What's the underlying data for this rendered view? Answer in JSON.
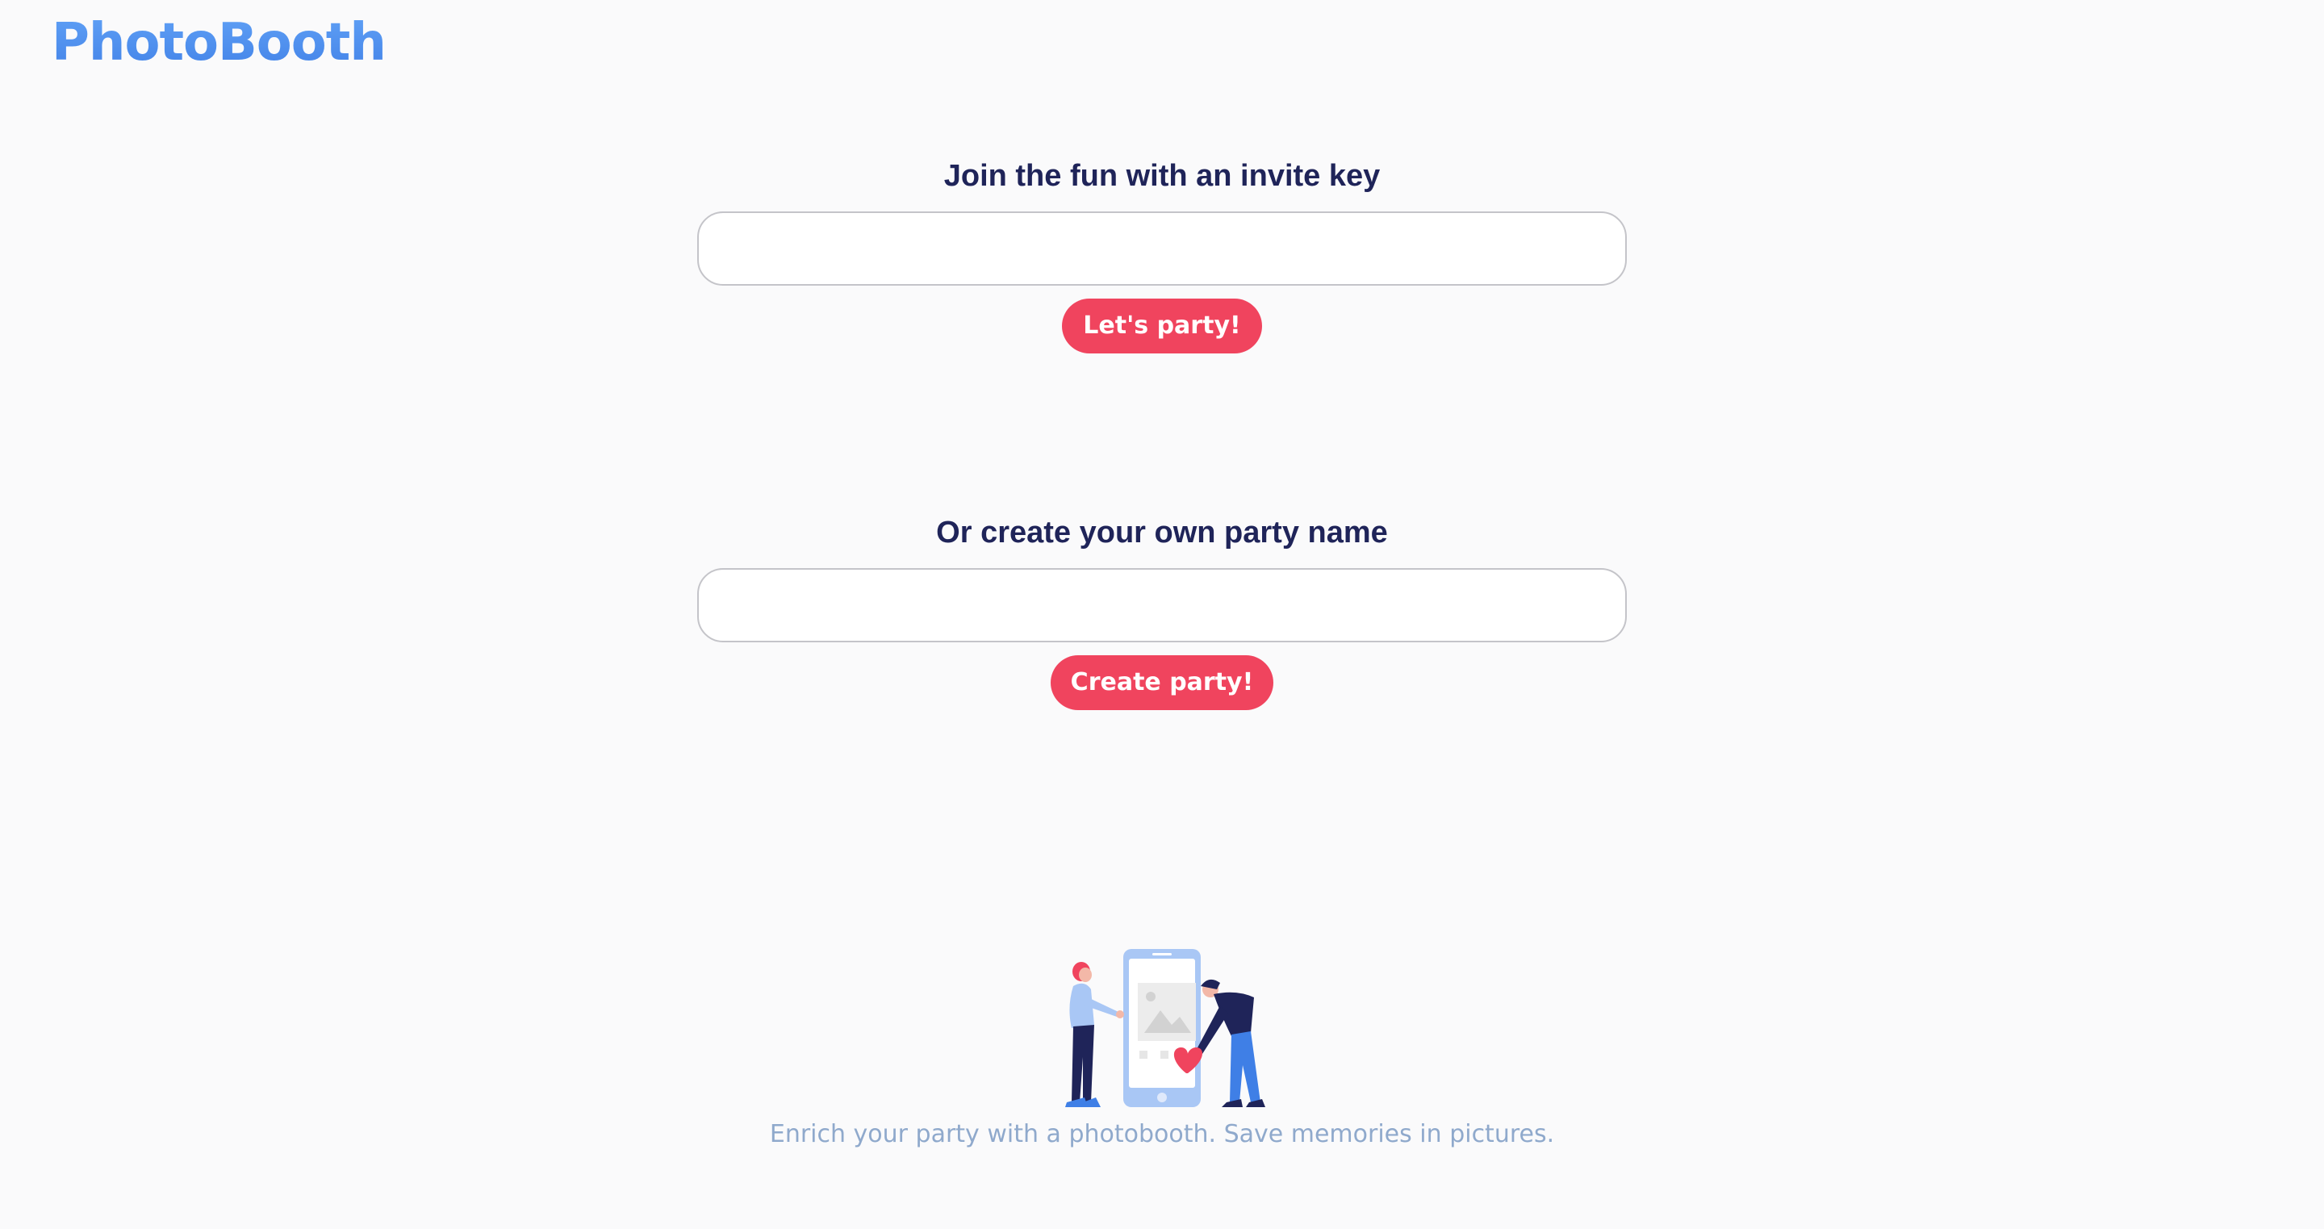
{
  "app": {
    "logo_text": "PhotoBooth"
  },
  "join": {
    "title": "Join the fun with an invite key",
    "input_value": "",
    "button_label": "Let's party!"
  },
  "create": {
    "title": "Or create your own party name",
    "input_value": "",
    "button_label": "Create party!"
  },
  "footer": {
    "tagline": "Enrich your party with a photobooth. Save memories in pictures."
  },
  "colors": {
    "background": "#fafafb",
    "logo": "#4a8ff0",
    "heading": "#1f2459",
    "button": "#f0445e",
    "tagline": "#8fa9cc",
    "input_border": "#c4c4c9"
  },
  "icons": {
    "illustration": "people-sharing-photo-illustration"
  }
}
